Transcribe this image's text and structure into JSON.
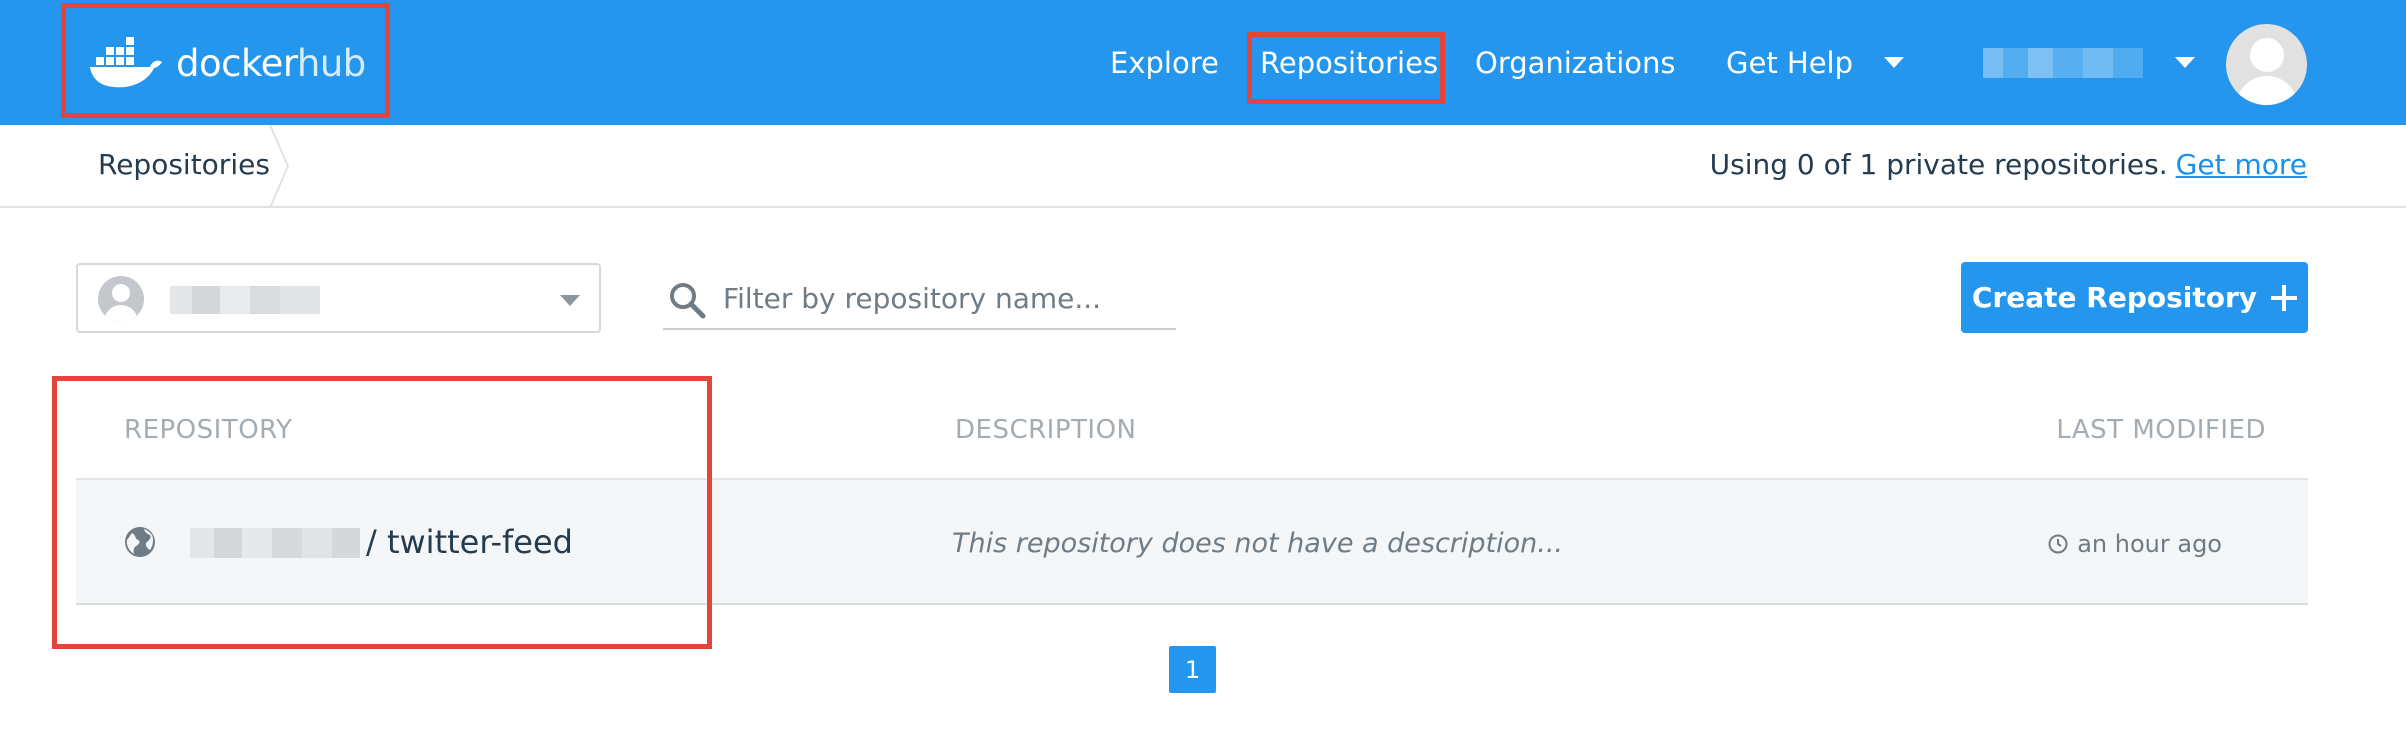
{
  "brand": {
    "logo_word1": "docker",
    "logo_word2": "hub"
  },
  "nav": {
    "items": [
      {
        "label": "Explore"
      },
      {
        "label": "Repositories"
      },
      {
        "label": "Organizations"
      },
      {
        "label": "Get Help"
      }
    ]
  },
  "subbar": {
    "breadcrumb": "Repositories",
    "usage_text": "Using 0 of 1 private repositories.",
    "usage_link": "Get more"
  },
  "controls": {
    "search_placeholder": "Filter by repository name...",
    "create_button": "Create Repository"
  },
  "table": {
    "headers": [
      "REPOSITORY",
      "DESCRIPTION",
      "LAST MODIFIED"
    ],
    "rows": [
      {
        "name": "/ twitter-feed",
        "description": "This repository does not have a description...",
        "last_modified": "an hour ago"
      }
    ]
  },
  "pagination": {
    "current_page": "1"
  },
  "colors": {
    "brand_blue": "#2496ed",
    "highlight_red": "#e2453c",
    "link_blue": "#1c90ed"
  }
}
